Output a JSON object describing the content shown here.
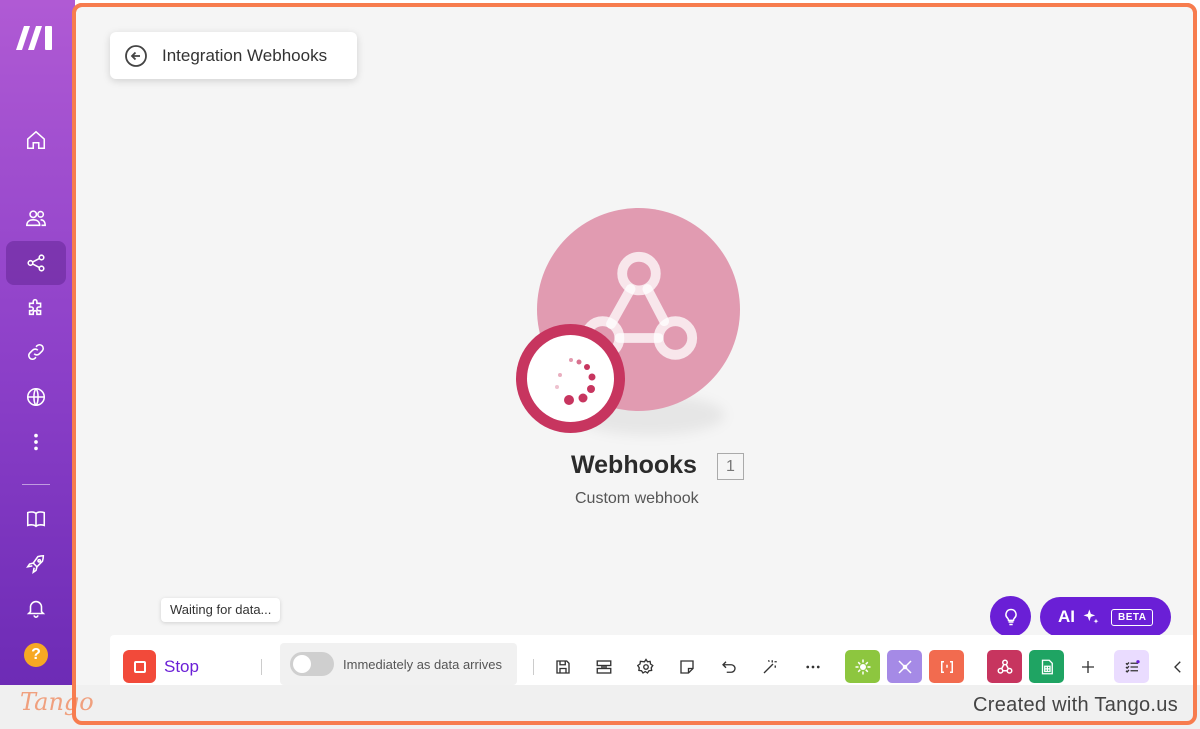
{
  "nav": {
    "items": [
      {
        "icon": "home-icon",
        "label": "Home"
      },
      {
        "icon": "team-icon",
        "label": "Team"
      },
      {
        "icon": "scenarios-icon",
        "label": "Scenarios",
        "active": true
      },
      {
        "icon": "apps-icon",
        "label": "Apps"
      },
      {
        "icon": "connections-icon",
        "label": "Connections"
      },
      {
        "icon": "globe-icon",
        "label": "Webhooks"
      },
      {
        "icon": "more-icon",
        "label": "More"
      },
      {
        "icon": "docs-icon",
        "label": "Documentation"
      },
      {
        "icon": "rocket-icon",
        "label": "What's new"
      },
      {
        "icon": "bell-icon",
        "label": "Notifications"
      }
    ],
    "help_label": "?"
  },
  "header": {
    "title": "Integration Webhooks"
  },
  "module": {
    "name": "Webhooks",
    "count": "1",
    "subtitle": "Custom webhook",
    "color": "#e19bb1",
    "status_color": "#c7355f"
  },
  "status": {
    "waiting_text": "Waiting for data..."
  },
  "assist": {
    "ai_label": "AI",
    "beta_label": "BETA",
    "accent": "#6a1fd6"
  },
  "toolbar": {
    "stop_label": "Stop",
    "schedule_label": "Immediately as data arrives",
    "schedule_enabled": false,
    "tools": [
      {
        "icon": "tools-icon",
        "color": "#8dc63f"
      },
      {
        "icon": "flow-control-icon",
        "color": "#a58ae6"
      },
      {
        "icon": "json-icon",
        "color": "#f26b4f"
      },
      {
        "icon": "webhooks-app-icon",
        "color": "#c7355f"
      },
      {
        "icon": "google-sheets-icon",
        "color": "#1fa463"
      }
    ]
  },
  "footer": {
    "brand": "Tango",
    "credit": "Created with Tango.us"
  }
}
